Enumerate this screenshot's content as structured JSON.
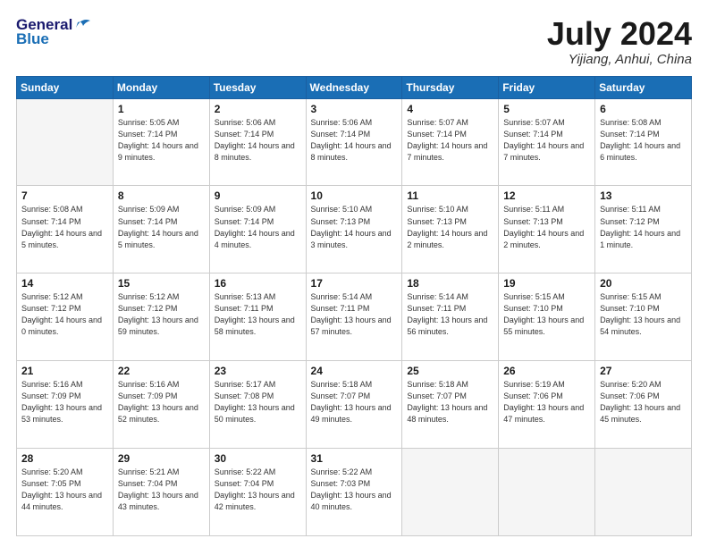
{
  "header": {
    "logo_line1": "General",
    "logo_line2": "Blue",
    "month": "July 2024",
    "location": "Yijiang, Anhui, China"
  },
  "weekdays": [
    "Sunday",
    "Monday",
    "Tuesday",
    "Wednesday",
    "Thursday",
    "Friday",
    "Saturday"
  ],
  "weeks": [
    [
      {
        "day": "",
        "sunrise": "",
        "sunset": "",
        "daylight": ""
      },
      {
        "day": "1",
        "sunrise": "Sunrise: 5:05 AM",
        "sunset": "Sunset: 7:14 PM",
        "daylight": "Daylight: 14 hours and 9 minutes."
      },
      {
        "day": "2",
        "sunrise": "Sunrise: 5:06 AM",
        "sunset": "Sunset: 7:14 PM",
        "daylight": "Daylight: 14 hours and 8 minutes."
      },
      {
        "day": "3",
        "sunrise": "Sunrise: 5:06 AM",
        "sunset": "Sunset: 7:14 PM",
        "daylight": "Daylight: 14 hours and 8 minutes."
      },
      {
        "day": "4",
        "sunrise": "Sunrise: 5:07 AM",
        "sunset": "Sunset: 7:14 PM",
        "daylight": "Daylight: 14 hours and 7 minutes."
      },
      {
        "day": "5",
        "sunrise": "Sunrise: 5:07 AM",
        "sunset": "Sunset: 7:14 PM",
        "daylight": "Daylight: 14 hours and 7 minutes."
      },
      {
        "day": "6",
        "sunrise": "Sunrise: 5:08 AM",
        "sunset": "Sunset: 7:14 PM",
        "daylight": "Daylight: 14 hours and 6 minutes."
      }
    ],
    [
      {
        "day": "7",
        "sunrise": "Sunrise: 5:08 AM",
        "sunset": "Sunset: 7:14 PM",
        "daylight": "Daylight: 14 hours and 5 minutes."
      },
      {
        "day": "8",
        "sunrise": "Sunrise: 5:09 AM",
        "sunset": "Sunset: 7:14 PM",
        "daylight": "Daylight: 14 hours and 5 minutes."
      },
      {
        "day": "9",
        "sunrise": "Sunrise: 5:09 AM",
        "sunset": "Sunset: 7:14 PM",
        "daylight": "Daylight: 14 hours and 4 minutes."
      },
      {
        "day": "10",
        "sunrise": "Sunrise: 5:10 AM",
        "sunset": "Sunset: 7:13 PM",
        "daylight": "Daylight: 14 hours and 3 minutes."
      },
      {
        "day": "11",
        "sunrise": "Sunrise: 5:10 AM",
        "sunset": "Sunset: 7:13 PM",
        "daylight": "Daylight: 14 hours and 2 minutes."
      },
      {
        "day": "12",
        "sunrise": "Sunrise: 5:11 AM",
        "sunset": "Sunset: 7:13 PM",
        "daylight": "Daylight: 14 hours and 2 minutes."
      },
      {
        "day": "13",
        "sunrise": "Sunrise: 5:11 AM",
        "sunset": "Sunset: 7:12 PM",
        "daylight": "Daylight: 14 hours and 1 minute."
      }
    ],
    [
      {
        "day": "14",
        "sunrise": "Sunrise: 5:12 AM",
        "sunset": "Sunset: 7:12 PM",
        "daylight": "Daylight: 14 hours and 0 minutes."
      },
      {
        "day": "15",
        "sunrise": "Sunrise: 5:12 AM",
        "sunset": "Sunset: 7:12 PM",
        "daylight": "Daylight: 13 hours and 59 minutes."
      },
      {
        "day": "16",
        "sunrise": "Sunrise: 5:13 AM",
        "sunset": "Sunset: 7:11 PM",
        "daylight": "Daylight: 13 hours and 58 minutes."
      },
      {
        "day": "17",
        "sunrise": "Sunrise: 5:14 AM",
        "sunset": "Sunset: 7:11 PM",
        "daylight": "Daylight: 13 hours and 57 minutes."
      },
      {
        "day": "18",
        "sunrise": "Sunrise: 5:14 AM",
        "sunset": "Sunset: 7:11 PM",
        "daylight": "Daylight: 13 hours and 56 minutes."
      },
      {
        "day": "19",
        "sunrise": "Sunrise: 5:15 AM",
        "sunset": "Sunset: 7:10 PM",
        "daylight": "Daylight: 13 hours and 55 minutes."
      },
      {
        "day": "20",
        "sunrise": "Sunrise: 5:15 AM",
        "sunset": "Sunset: 7:10 PM",
        "daylight": "Daylight: 13 hours and 54 minutes."
      }
    ],
    [
      {
        "day": "21",
        "sunrise": "Sunrise: 5:16 AM",
        "sunset": "Sunset: 7:09 PM",
        "daylight": "Daylight: 13 hours and 53 minutes."
      },
      {
        "day": "22",
        "sunrise": "Sunrise: 5:16 AM",
        "sunset": "Sunset: 7:09 PM",
        "daylight": "Daylight: 13 hours and 52 minutes."
      },
      {
        "day": "23",
        "sunrise": "Sunrise: 5:17 AM",
        "sunset": "Sunset: 7:08 PM",
        "daylight": "Daylight: 13 hours and 50 minutes."
      },
      {
        "day": "24",
        "sunrise": "Sunrise: 5:18 AM",
        "sunset": "Sunset: 7:07 PM",
        "daylight": "Daylight: 13 hours and 49 minutes."
      },
      {
        "day": "25",
        "sunrise": "Sunrise: 5:18 AM",
        "sunset": "Sunset: 7:07 PM",
        "daylight": "Daylight: 13 hours and 48 minutes."
      },
      {
        "day": "26",
        "sunrise": "Sunrise: 5:19 AM",
        "sunset": "Sunset: 7:06 PM",
        "daylight": "Daylight: 13 hours and 47 minutes."
      },
      {
        "day": "27",
        "sunrise": "Sunrise: 5:20 AM",
        "sunset": "Sunset: 7:06 PM",
        "daylight": "Daylight: 13 hours and 45 minutes."
      }
    ],
    [
      {
        "day": "28",
        "sunrise": "Sunrise: 5:20 AM",
        "sunset": "Sunset: 7:05 PM",
        "daylight": "Daylight: 13 hours and 44 minutes."
      },
      {
        "day": "29",
        "sunrise": "Sunrise: 5:21 AM",
        "sunset": "Sunset: 7:04 PM",
        "daylight": "Daylight: 13 hours and 43 minutes."
      },
      {
        "day": "30",
        "sunrise": "Sunrise: 5:22 AM",
        "sunset": "Sunset: 7:04 PM",
        "daylight": "Daylight: 13 hours and 42 minutes."
      },
      {
        "day": "31",
        "sunrise": "Sunrise: 5:22 AM",
        "sunset": "Sunset: 7:03 PM",
        "daylight": "Daylight: 13 hours and 40 minutes."
      },
      {
        "day": "",
        "sunrise": "",
        "sunset": "",
        "daylight": ""
      },
      {
        "day": "",
        "sunrise": "",
        "sunset": "",
        "daylight": ""
      },
      {
        "day": "",
        "sunrise": "",
        "sunset": "",
        "daylight": ""
      }
    ]
  ]
}
